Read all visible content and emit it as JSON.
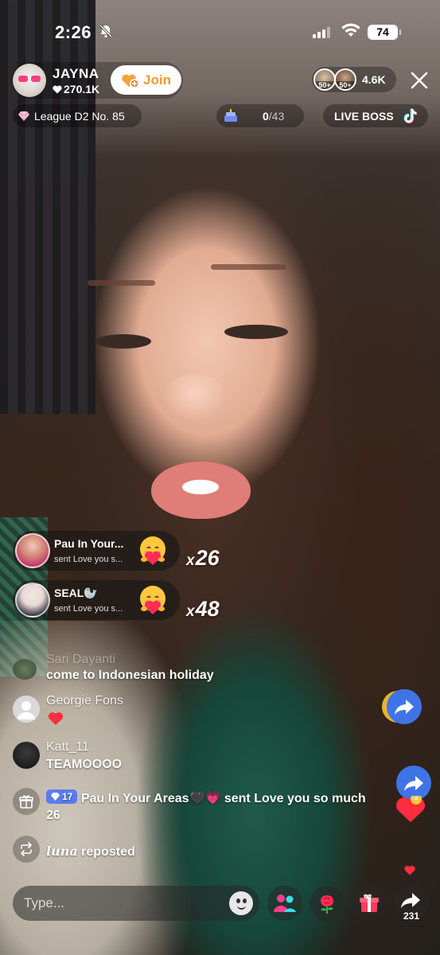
{
  "status_bar": {
    "time": "2:26",
    "battery": "74"
  },
  "host": {
    "name": "JAYNA",
    "likes": "270.1K",
    "join_label": "Join"
  },
  "viewers": {
    "count": "4.6K",
    "badge_1": "50+",
    "badge_2": "50+"
  },
  "info_bar": {
    "league": "League D2 No. 85",
    "goal_current": "0",
    "goal_total": "/43",
    "live_boss": "LIVE BOSS"
  },
  "gifts": [
    {
      "name": "Pau In Your...",
      "subtitle": "sent Love you s...",
      "combo_prefix": "x",
      "combo": "26"
    },
    {
      "name": "SEAL🦭",
      "subtitle": "sent Love you s...",
      "combo_prefix": "x",
      "combo": "48"
    }
  ],
  "comments": {
    "faded_name": "Sari Dayanti",
    "faded_text": "come to Indonesian holiday",
    "items": [
      {
        "name": "Georgie Fons",
        "text": ""
      },
      {
        "name": "Katt_11",
        "text": "TEAMOOOO"
      }
    ]
  },
  "system": {
    "level": "17",
    "gift_line": "Pau In Your Areas🖤💗 sent Love you so much",
    "gift_count": "26",
    "repost_user": "luna",
    "repost_text": "reposted"
  },
  "bottom_bar": {
    "placeholder": "Type...",
    "share_count": "231"
  },
  "colors": {
    "join_text": "#f49a2c",
    "accent_blue": "#3f74e8",
    "level_badge": "#5b7cf0",
    "heart": "#ff2d55"
  }
}
